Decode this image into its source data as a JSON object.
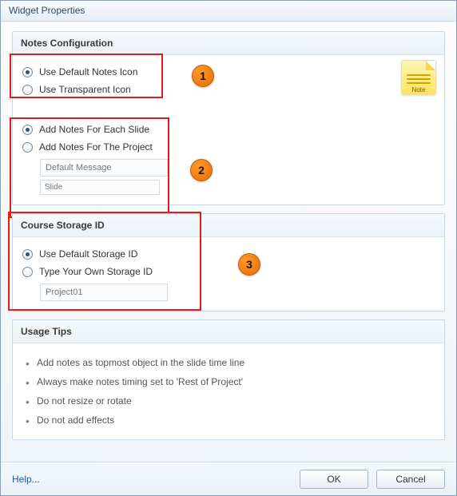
{
  "window": {
    "title": "Widget Properties"
  },
  "notesConfig": {
    "header": "Notes Configuration",
    "iconGroup": {
      "useDefault": "Use Default Notes Icon",
      "useTransparent": "Use Transparent Icon"
    },
    "scopeGroup": {
      "eachSlide": "Add Notes For Each Slide",
      "project": "Add Notes For The Project",
      "defaultMsgPlaceholder": "Default Message",
      "slidePlaceholder": "Slide"
    },
    "noteIcon": {
      "label": "Note"
    }
  },
  "storage": {
    "header": "Course Storage ID",
    "useDefault": "Use Default Storage ID",
    "typeOwn": "Type Your Own Storage ID",
    "idPlaceholder": "Project01"
  },
  "usage": {
    "header": "Usage Tips",
    "tips": [
      "Add notes as  topmost object in the slide time line",
      "Always make notes timing set to 'Rest of Project'",
      "Do not resize or rotate",
      "Do not add effects"
    ]
  },
  "callouts": {
    "one": "1",
    "two": "2",
    "three": "3"
  },
  "footer": {
    "help": "Help...",
    "ok": "OK",
    "cancel": "Cancel"
  }
}
